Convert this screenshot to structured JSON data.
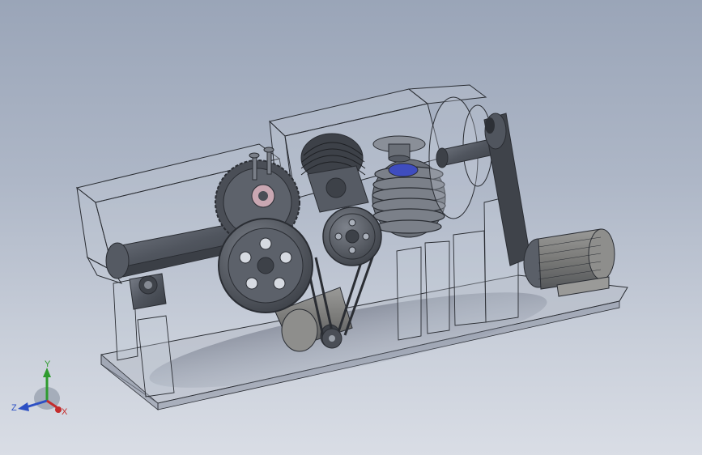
{
  "viewport": {
    "background_top": "#9aa5b8",
    "background_bottom": "#d9dde5"
  },
  "model": {
    "body_color": "#5a5f68",
    "transparent_color": "#c4cbd6",
    "edge_color": "#2a2d33"
  },
  "triad": {
    "y_label": "Y",
    "z_label": "Z",
    "x_label": "X",
    "y_color": "#2e9b2e",
    "z_color": "#2c4fc4",
    "x_color": "#c42c2c"
  }
}
